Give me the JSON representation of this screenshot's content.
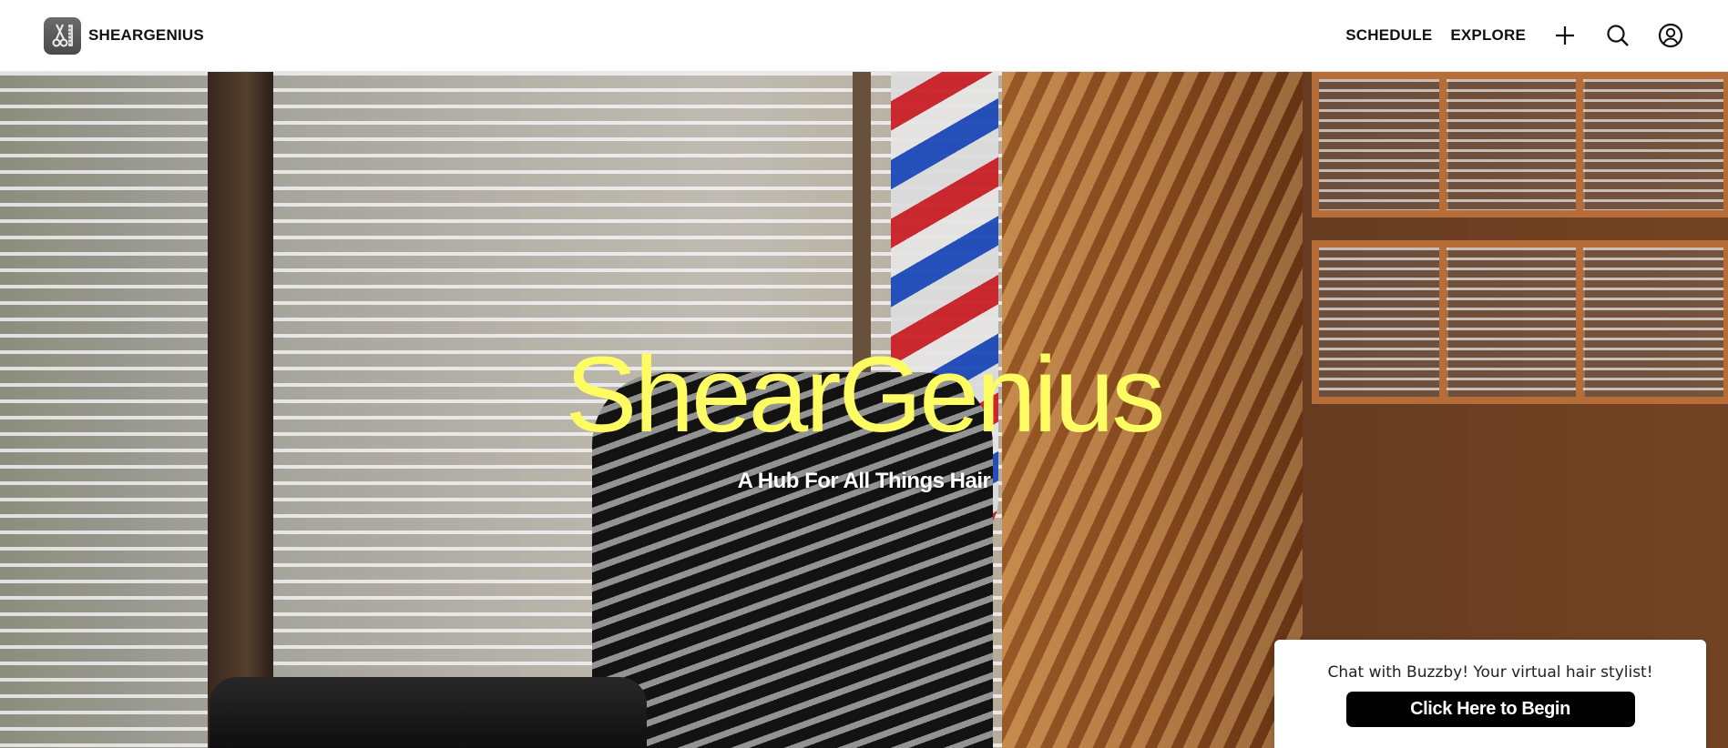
{
  "header": {
    "brand_name": "SHEARGENIUS",
    "logo_icon": "scissors-comb-logo-icon",
    "nav": {
      "schedule_label": "SCHEDULE",
      "explore_label": "EXPLORE"
    },
    "icons": [
      "plus-icon",
      "search-icon",
      "user-account-icon"
    ]
  },
  "hero": {
    "title": "ShearGenius",
    "subtitle": "A Hub For All Things Hair",
    "title_color": "#fdfc63"
  },
  "chat_widget": {
    "message": "Chat with Buzzby! Your virtual hair stylist!",
    "button_label": "Click Here to Begin"
  }
}
